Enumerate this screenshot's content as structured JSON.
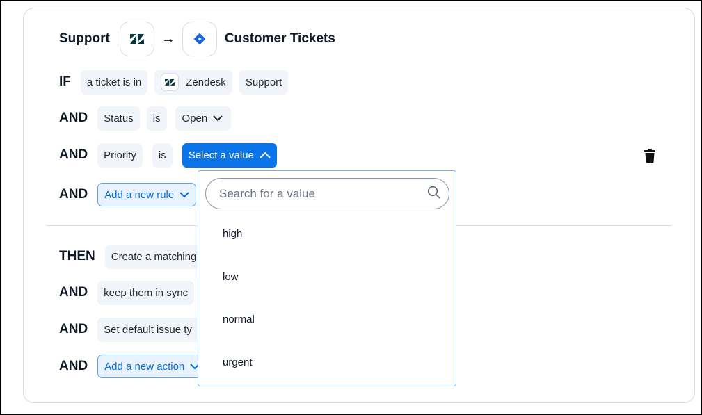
{
  "header": {
    "source_label": "Support",
    "source_app_icon": "zendesk-logo",
    "arrow": "→",
    "target_app_icon": "jira-logo",
    "target_label": "Customer Tickets"
  },
  "conditions": [
    {
      "keyword": "IF",
      "chips": [
        "a ticket is in",
        "Zendesk",
        "Support"
      ]
    },
    {
      "keyword": "AND",
      "field": "Status",
      "operator": "is",
      "value": "Open"
    },
    {
      "keyword": "AND",
      "field": "Priority",
      "operator": "is",
      "value": "Select a value"
    },
    {
      "keyword": "AND",
      "add_label": "Add a new rule"
    }
  ],
  "actions": [
    {
      "keyword": "THEN",
      "label": "Create a matching"
    },
    {
      "keyword": "AND",
      "label": "keep them in sync"
    },
    {
      "keyword": "AND",
      "label": "Set default issue ty"
    },
    {
      "keyword": "AND",
      "add_label": "Add a new action"
    }
  ],
  "dropdown": {
    "search_placeholder": "Search for a value",
    "search_value": "",
    "options": [
      "high",
      "low",
      "normal",
      "urgent"
    ]
  },
  "colors": {
    "primary": "#0a74e8",
    "chip_bg": "#f1f4f8",
    "zendesk": "#03363d",
    "jira": "#1868db"
  }
}
